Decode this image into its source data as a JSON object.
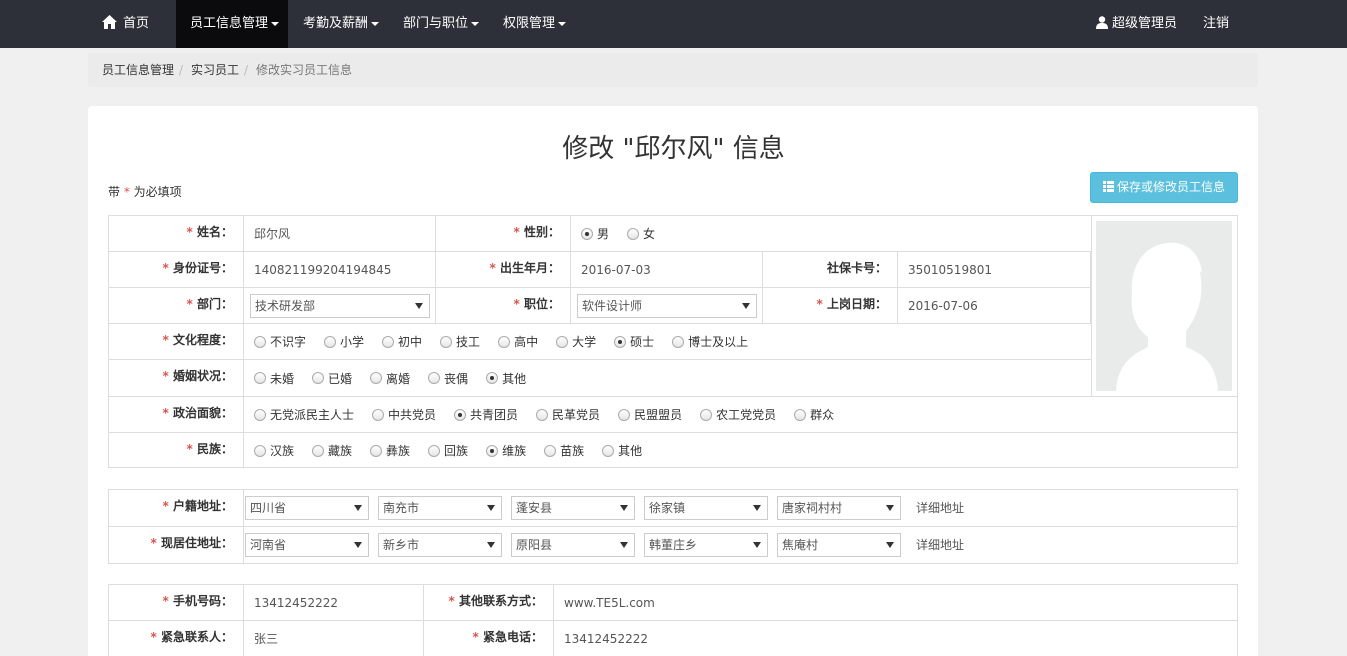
{
  "nav": {
    "home": "首页",
    "items": [
      {
        "label": "员工信息管理",
        "active": true
      },
      {
        "label": "考勤及薪酬",
        "active": false
      },
      {
        "label": "部门与职位",
        "active": false
      },
      {
        "label": "权限管理",
        "active": false
      }
    ],
    "user": "超级管理员",
    "logout": "注销"
  },
  "breadcrumb": [
    "员工信息管理",
    "实习员工",
    "修改实习员工信息"
  ],
  "page": {
    "title": "修改 \"邱尔风\" 信息",
    "required_prefix": "带",
    "required_star": "*",
    "required_suffix": "为必填项",
    "save_button": "保存或修改员工信息"
  },
  "basic": {
    "name_label": "姓名：",
    "name": "邱尔风",
    "gender_label": "性别：",
    "gender_options": [
      "男",
      "女"
    ],
    "gender_selected": 0,
    "id_label": "身份证号：",
    "id": "140821199204194845",
    "birth_label": "出生年月：",
    "birth": "2016-07-03",
    "social_label": "社保卡号：",
    "social": "35010519801",
    "dept_label": "部门：",
    "dept": "技术研发部",
    "position_label": "职位：",
    "position": "软件设计师",
    "start_label": "上岗日期：",
    "start": "2016-07-06",
    "edu_label": "文化程度：",
    "edu_options": [
      "不识字",
      "小学",
      "初中",
      "技工",
      "高中",
      "大学",
      "硕士",
      "博士及以上"
    ],
    "edu_selected": 6,
    "marriage_label": "婚姻状况：",
    "marriage_options": [
      "未婚",
      "已婚",
      "离婚",
      "丧偶",
      "其他"
    ],
    "marriage_selected": 4,
    "politics_label": "政治面貌：",
    "politics_options": [
      "无党派民主人士",
      "中共党员",
      "共青团员",
      "民革党员",
      "民盟盟员",
      "农工党党员",
      "群众"
    ],
    "politics_selected": 2,
    "nation_label": "民族：",
    "nation_options": [
      "汉族",
      "藏族",
      "彝族",
      "回族",
      "维族",
      "苗族",
      "其他"
    ],
    "nation_selected": 4
  },
  "address": {
    "household_label": "户籍地址：",
    "household": [
      "四川省",
      "南充市",
      "蓬安县",
      "徐家镇",
      "唐家祠村村"
    ],
    "household_detail": "详细地址",
    "current_label": "现居住地址：",
    "current": [
      "河南省",
      "新乡市",
      "原阳县",
      "韩董庄乡",
      "焦庵村"
    ],
    "current_detail": "详细地址"
  },
  "contact": {
    "phone_label": "手机号码：",
    "phone": "13412452222",
    "other_label": "其他联系方式：",
    "other": "www.TE5L.com",
    "emergency_label": "紧急联系人：",
    "emergency": "张三",
    "emergency_phone_label": "紧急电话：",
    "emergency_phone": "13412452222"
  }
}
